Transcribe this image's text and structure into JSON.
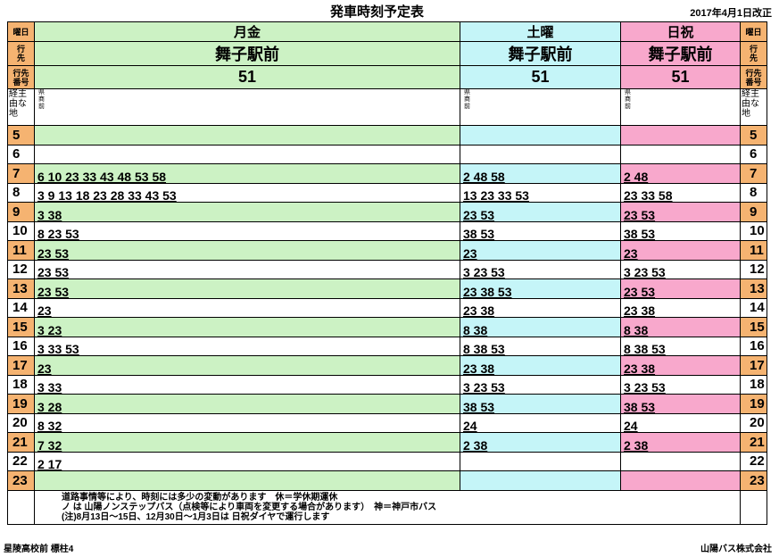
{
  "header": {
    "title": "発車時刻予定表",
    "revision": "2017年4月1日改正"
  },
  "side": {
    "day_label": "曜日",
    "dest_label": "行\n先",
    "route_label": "行先\n番号",
    "via_label": "経主\n由な\n地"
  },
  "columns": {
    "weekday": {
      "name": "月金",
      "destination": "舞子駅前",
      "route": "51",
      "via": "県\n商\n前"
    },
    "saturday": {
      "name": "土曜",
      "destination": "舞子駅前",
      "route": "51",
      "via": "県\n商\n前"
    },
    "holiday": {
      "name": "日祝",
      "destination": "舞子駅前",
      "route": "51",
      "via": "県\n商\n前"
    }
  },
  "rows": [
    {
      "hour": "5",
      "weekday": "",
      "saturday": "",
      "holiday": ""
    },
    {
      "hour": "6",
      "weekday": "",
      "saturday": "",
      "holiday": ""
    },
    {
      "hour": "7",
      "weekday": "6 10 23 33 43 48 53 58",
      "saturday": "2 48 58",
      "holiday": "2 48"
    },
    {
      "hour": "8",
      "weekday": "3 9 13 18 23 28 33 43 53",
      "saturday": "13 23 33 53",
      "holiday": "23 33 58"
    },
    {
      "hour": "9",
      "weekday": "3 38",
      "saturday": "23 53",
      "holiday": "23 53"
    },
    {
      "hour": "10",
      "weekday": "8 23 53",
      "saturday": "38 53",
      "holiday": "38 53"
    },
    {
      "hour": "11",
      "weekday": "23 53",
      "saturday": "23",
      "holiday": "23"
    },
    {
      "hour": "12",
      "weekday": "23 53",
      "saturday": "3 23 53",
      "holiday": "3 23 53"
    },
    {
      "hour": "13",
      "weekday": "23 53",
      "saturday": "23 38 53",
      "holiday": "23 53"
    },
    {
      "hour": "14",
      "weekday": "23",
      "saturday": "23 38",
      "holiday": "23 38"
    },
    {
      "hour": "15",
      "weekday": "3 23",
      "saturday": "8 38",
      "holiday": "8 38"
    },
    {
      "hour": "16",
      "weekday": "3 33 53",
      "saturday": "8 38 53",
      "holiday": "8 38 53"
    },
    {
      "hour": "17",
      "weekday": "23",
      "saturday": "23 38",
      "holiday": "23 38"
    },
    {
      "hour": "18",
      "weekday": "3 33",
      "saturday": "3 23 53",
      "holiday": "3 23 53"
    },
    {
      "hour": "19",
      "weekday": "3 28",
      "saturday": "38 53",
      "holiday": "38 53"
    },
    {
      "hour": "20",
      "weekday": "8 32",
      "saturday": "24",
      "holiday": "24"
    },
    {
      "hour": "21",
      "weekday": "7 32",
      "saturday": "2 38",
      "holiday": "2 38"
    },
    {
      "hour": "22",
      "weekday": "2 17",
      "saturday": "",
      "holiday": ""
    },
    {
      "hour": "23",
      "weekday": "",
      "saturday": "",
      "holiday": ""
    }
  ],
  "notes": {
    "line1": "道路事情等により、時刻には多少の変動があります　休＝学休期運休",
    "line2": "ノ は 山陽ノンステップバス（点検等により車両を変更する場合があります）　神＝神戸市バス",
    "line3": "(注)8月13日～15日、12月30日～1月3日は 日祝ダイヤで運行します"
  },
  "footer": {
    "stop": "星陵高校前 標柱4",
    "company": "山陽バス株式会社"
  }
}
